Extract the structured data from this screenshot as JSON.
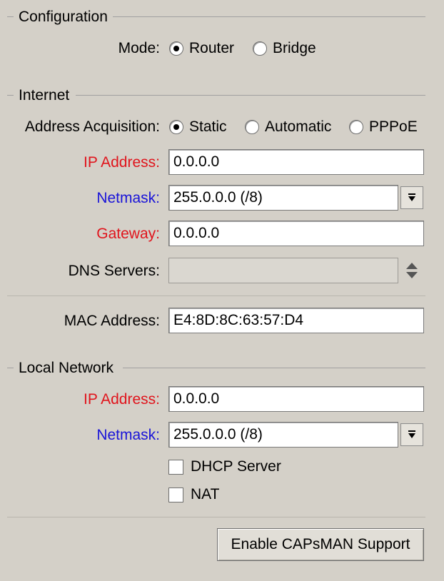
{
  "configuration": {
    "title": "Configuration",
    "mode_label": "Mode:",
    "mode_options": [
      "Router",
      "Bridge"
    ],
    "mode_selected": "Router"
  },
  "internet": {
    "title": "Internet",
    "acquisition_label": "Address Acquisition:",
    "acquisition_options": [
      "Static",
      "Automatic",
      "PPPoE"
    ],
    "acquisition_selected": "Static",
    "ip_label": "IP Address:",
    "ip_value": "0.0.0.0",
    "netmask_label": "Netmask:",
    "netmask_value": "255.0.0.0 (/8)",
    "gateway_label": "Gateway:",
    "gateway_value": "0.0.0.0",
    "dns_label": "DNS Servers:",
    "dns_value": "",
    "mac_label": "MAC Address:",
    "mac_value": "E4:8D:8C:63:57:D4"
  },
  "local_network": {
    "title": "Local Network",
    "ip_label": "IP Address:",
    "ip_value": "0.0.0.0",
    "netmask_label": "Netmask:",
    "netmask_value": "255.0.0.0 (/8)",
    "dhcp_label": "DHCP Server",
    "dhcp_checked": false,
    "nat_label": "NAT",
    "nat_checked": false
  },
  "capsman_button_label": "Enable CAPsMAN Support",
  "colors": {
    "background": "#d4d0c8",
    "required_label": "#e0141c",
    "link_label": "#1a14d8"
  },
  "icons": {
    "dropdown": "dropdown-arrow-icon",
    "spin": "up-down-spin-icon"
  }
}
